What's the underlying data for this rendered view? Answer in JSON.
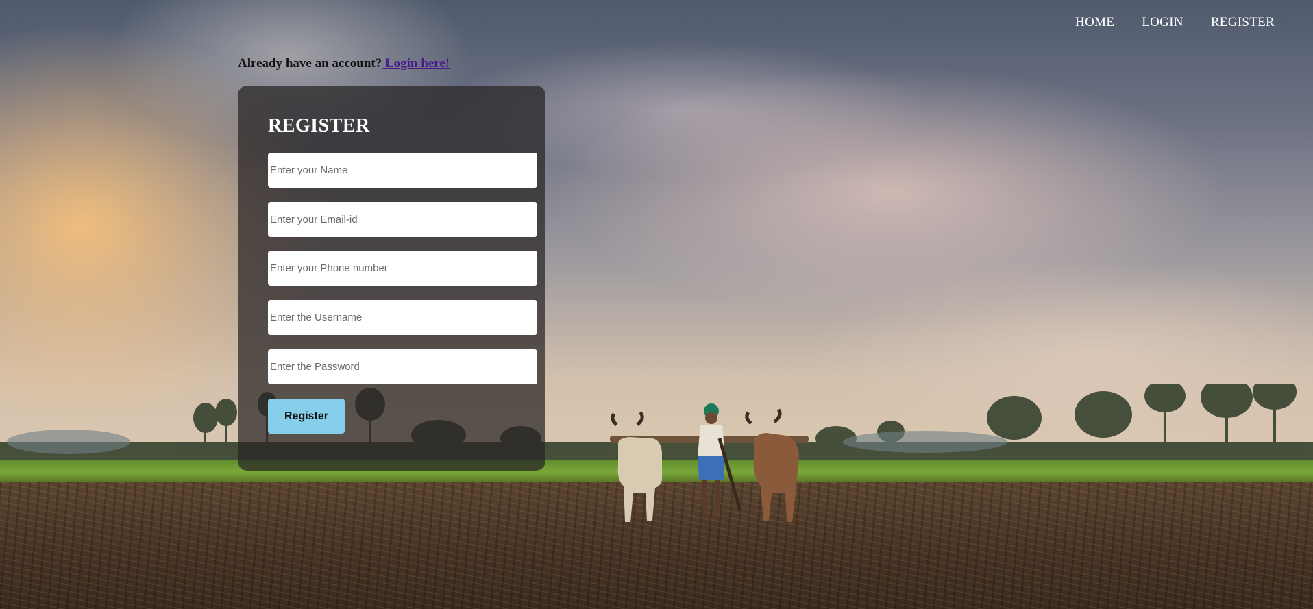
{
  "nav": {
    "items": [
      {
        "label": "HOME"
      },
      {
        "label": "LOGIN"
      },
      {
        "label": "REGISTER"
      }
    ]
  },
  "account_prompt": {
    "text": "Already have an account?",
    "link_label": " Login here!"
  },
  "form": {
    "title": "REGISTER",
    "fields": [
      {
        "placeholder": "Enter your Name",
        "value": ""
      },
      {
        "placeholder": "Enter your Email-id",
        "value": ""
      },
      {
        "placeholder": "Enter your Phone number",
        "value": ""
      },
      {
        "placeholder": "Enter the Username",
        "value": ""
      },
      {
        "placeholder": "Enter the Password",
        "value": ""
      }
    ],
    "submit_label": "Register"
  },
  "colors": {
    "button_bg": "#87ceeb",
    "link": "#4a1a8c",
    "card_bg": "rgba(40,36,36,0.72)"
  },
  "background": {
    "icon": "farm-field-photo"
  }
}
